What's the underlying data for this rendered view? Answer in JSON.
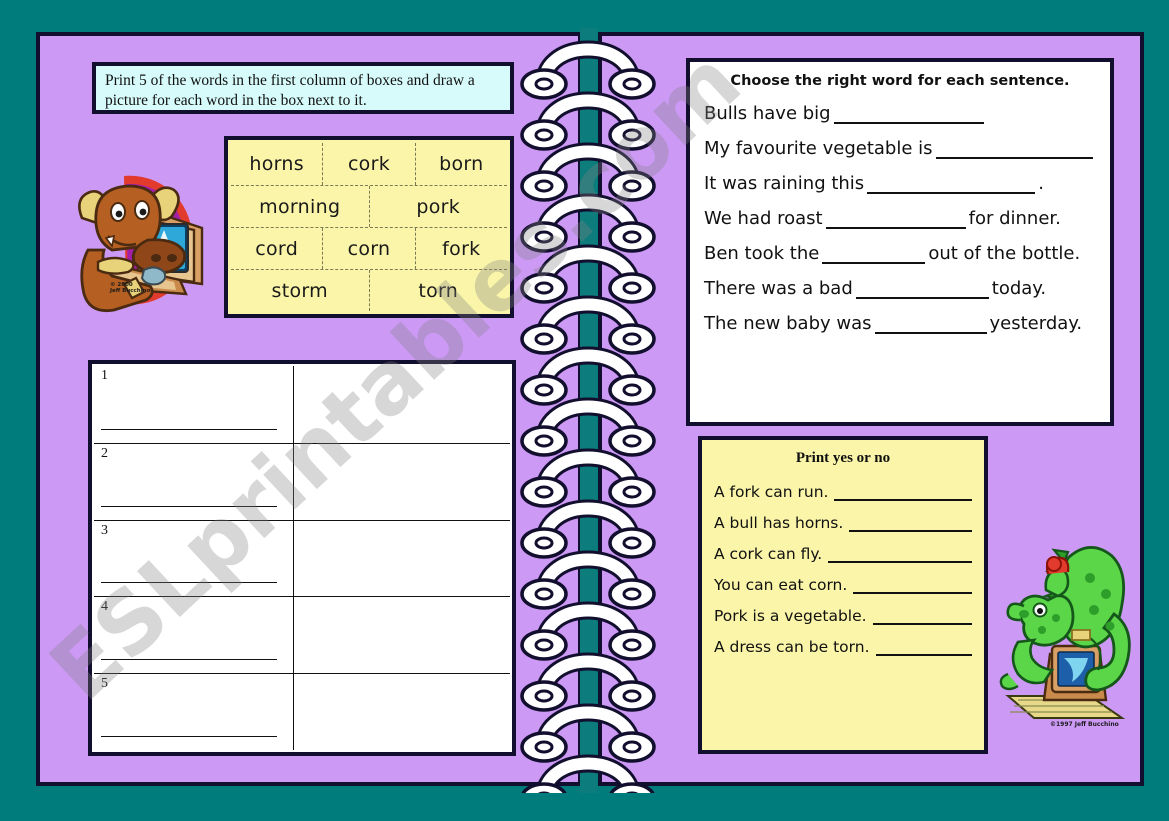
{
  "colors": {
    "background_teal": "#017C7C",
    "page_purple": "#CC99F5",
    "border_navy": "#120E2E",
    "instruction_cyan": "#D7FAFA",
    "word_bank_yellow": "#FAF5A8",
    "spine_teal": "#0C7C7C"
  },
  "instruction": {
    "text": "Print 5 of the words in the first column of boxes and draw a picture for each word in the box next to it."
  },
  "word_bank": {
    "rows": [
      [
        "horns",
        "cork",
        "born"
      ],
      [
        "morning",
        "pork"
      ],
      [
        "cord",
        "corn",
        "fork"
      ],
      [
        "storm",
        "torn"
      ]
    ]
  },
  "draw_grid": {
    "numbers": [
      "1",
      "2",
      "3",
      "4",
      "5"
    ]
  },
  "sentence_panel": {
    "title": "Choose the right word for each sentence.",
    "sentences": [
      {
        "before": "Bulls have big",
        "blank_width": 150,
        "after": ""
      },
      {
        "before": "My favourite vegetable is",
        "blank_width": 165,
        "after": ""
      },
      {
        "before": "It was raining this",
        "blank_width": 168,
        "after": "."
      },
      {
        "before": "We had roast",
        "blank_width": 140,
        "after": "for dinner."
      },
      {
        "before": "Ben took the",
        "blank_width": 103,
        "after": "out of the bottle."
      },
      {
        "before": "There was a bad",
        "blank_width": 133,
        "after": "today."
      },
      {
        "before": "The new baby was",
        "blank_width": 112,
        "after": "yesterday."
      }
    ]
  },
  "yesno_panel": {
    "title": "Print yes or no",
    "items": [
      "A fork can run.",
      "A bull has horns.",
      "A cork can fly.",
      "You can eat corn.",
      "Pork is a vegetable.",
      "A dress can be torn."
    ]
  },
  "clipart": {
    "bull": {
      "name": "bull-at-computer",
      "copyright": "© 2000\nJeff Bucchino"
    },
    "dragon": {
      "name": "dragon-at-computer",
      "copyright": "©1997 Jeff Bucchino"
    }
  },
  "watermark": {
    "text": "ESLprintables.com"
  }
}
